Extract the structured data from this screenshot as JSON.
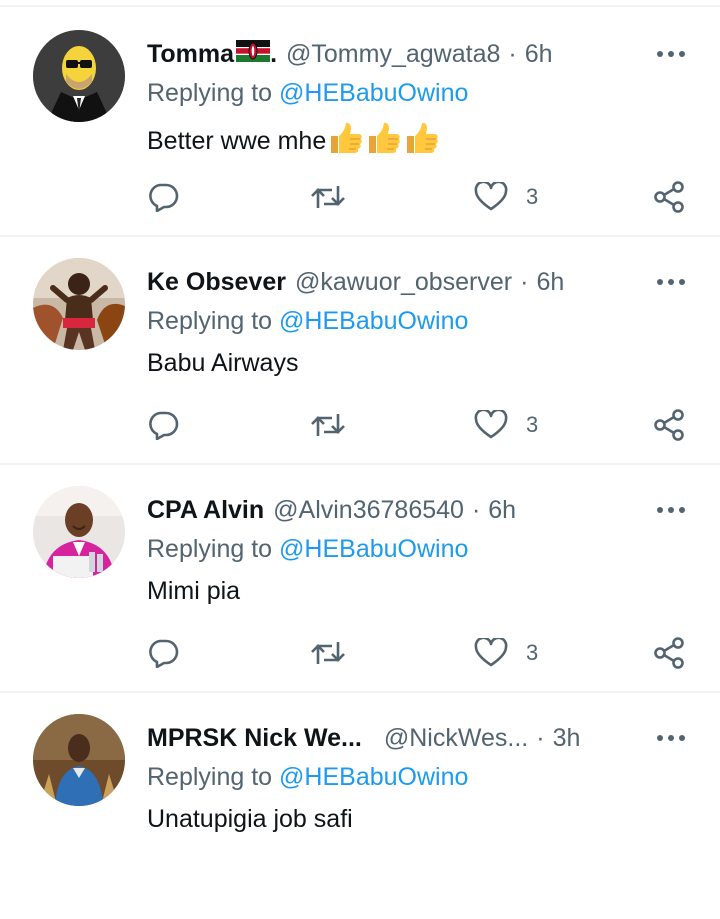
{
  "colors": {
    "accent": "#1d9bf0",
    "secondary_text": "#536471",
    "divider": "#eff3f4"
  },
  "tweets": [
    {
      "name": "Tomma",
      "name_suffix": ".",
      "has_flag": true,
      "handle": "@Tommy_agwata8",
      "sep": "·",
      "time": "6h",
      "replying_prefix": "Replying to",
      "replying_to": "@HEBabuOwino",
      "text": "Better wwe mhe",
      "emoji_count": 3,
      "like_count": "3",
      "avatar": "cartoon-character-avatar"
    },
    {
      "name": "Ke Obsever",
      "name_suffix": "",
      "has_flag": false,
      "handle": "@kawuor_observer",
      "sep": "·",
      "time": "6h",
      "replying_prefix": "Replying to",
      "replying_to": "@HEBabuOwino",
      "text": "Babu Airways",
      "emoji_count": 0,
      "like_count": "3",
      "avatar": "person-photo-avatar"
    },
    {
      "name": "CPA Alvin",
      "name_suffix": "",
      "has_flag": false,
      "handle": "@Alvin36786540",
      "sep": "·",
      "time": "6h",
      "replying_prefix": "Replying to",
      "replying_to": "@HEBabuOwino",
      "text": "Mimi pia",
      "emoji_count": 0,
      "like_count": "3",
      "avatar": "person-photo-avatar"
    },
    {
      "name": "MPRSK Nick We...",
      "name_suffix": "",
      "has_flag": false,
      "handle": "@NickWes...",
      "sep": "·",
      "time": "3h",
      "replying_prefix": "Replying to",
      "replying_to": "@HEBabuOwino",
      "text": "Unatupigia job safi",
      "emoji_count": 0,
      "like_count": "",
      "avatar": "person-photo-avatar"
    }
  ]
}
